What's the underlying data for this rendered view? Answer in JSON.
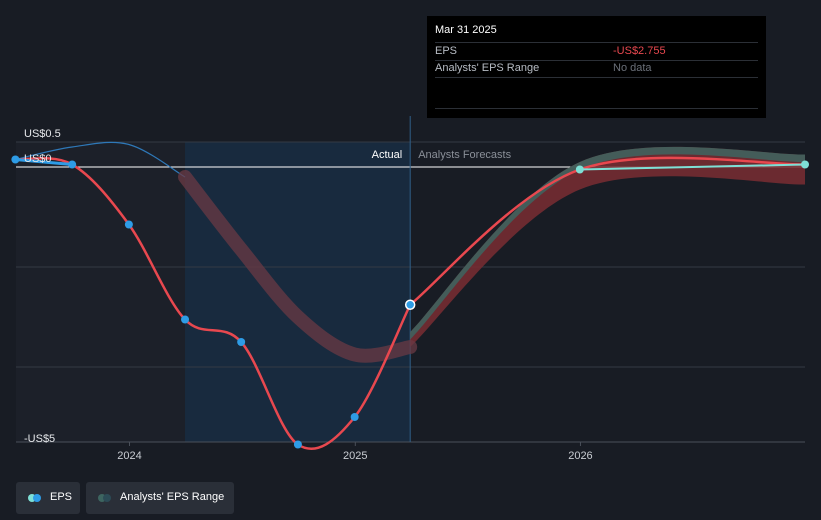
{
  "tooltip": {
    "date": "Mar 31 2025",
    "rows": [
      {
        "label": "EPS",
        "value": "-US$2.755"
      },
      {
        "label": "Analysts' EPS Range",
        "value": "No data"
      }
    ]
  },
  "legend": [
    {
      "label": "EPS"
    },
    {
      "label": "Analysts' EPS Range"
    }
  ],
  "colors": {
    "background": "#181c24",
    "eps_actual": "#2e9ce6",
    "eps_forecast": "#e8484f",
    "range_band": "#7a2d33",
    "range_band_upper": "#3d6560",
    "forecast_line": "#7ee0d6",
    "tooltip_negative": "#e8484f",
    "tooltip_nodata": "#6b7079"
  },
  "chart_data": {
    "type": "line",
    "y_ticks": [
      "US$0.5",
      "US$0",
      "-US$5"
    ],
    "x_ticks": [
      "2024",
      "2025",
      "2026"
    ],
    "ylim": [
      -5.5,
      0.5
    ],
    "xlim": [
      "2023-07-01",
      "2026-12-31"
    ],
    "labels": {
      "actual": "Actual",
      "forecast": "Analysts Forecasts"
    },
    "divider_date": "2025-03-31",
    "highlight_from": "2024-03-31",
    "grid": true,
    "series": [
      {
        "name": "EPS",
        "points": [
          {
            "date": "2023-06-30",
            "value": 0.15
          },
          {
            "date": "2023-09-30",
            "value": 0.05
          },
          {
            "date": "2023-12-31",
            "value": -1.15
          },
          {
            "date": "2024-03-31",
            "value": -3.05
          },
          {
            "date": "2024-06-30",
            "value": -3.5
          },
          {
            "date": "2024-09-30",
            "value": -5.55
          },
          {
            "date": "2024-12-31",
            "value": -5.0
          },
          {
            "date": "2025-03-31",
            "value": -2.755
          }
        ]
      },
      {
        "name": "EPS",
        "points": [
          {
            "date": "2025-03-31",
            "value": -2.755
          },
          {
            "date": "2025-12-31",
            "value": -0.05
          },
          {
            "date": "2026-12-31",
            "value": 0.05
          }
        ]
      }
    ],
    "comparison_line": [
      {
        "date": "2023-06-30",
        "value": 0.15
      },
      {
        "date": "2023-09-30",
        "value": 0.4
      },
      {
        "date": "2023-12-31",
        "value": 0.45
      },
      {
        "date": "2024-03-31",
        "value": -0.2
      },
      {
        "date": "2024-06-30",
        "value": -1.65
      },
      {
        "date": "2024-09-30",
        "value": -3.0
      },
      {
        "date": "2024-12-31",
        "value": -3.75
      },
      {
        "date": "2025-03-31",
        "value": -3.6
      }
    ],
    "range_band": [
      {
        "date": "2025-03-31",
        "low": -3.6,
        "high": -3.3
      },
      {
        "date": "2025-12-31",
        "low": -0.45,
        "high": 0.1
      },
      {
        "date": "2026-12-31",
        "low": -0.35,
        "high": 0.25
      }
    ]
  }
}
